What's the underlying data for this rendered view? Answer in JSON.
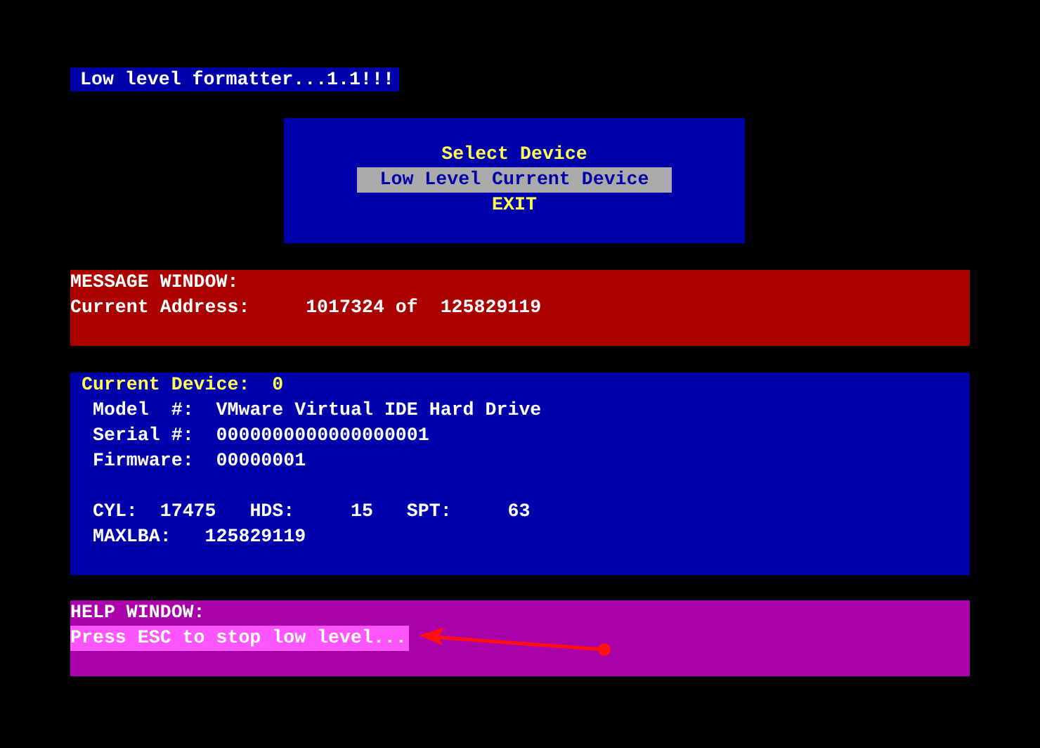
{
  "title": "Low level formatter...1.1!!!",
  "menu": {
    "items": [
      {
        "label": "Select Device",
        "selected": false
      },
      {
        "label": "Low Level Current Device",
        "selected": true
      },
      {
        "label": "EXIT",
        "selected": false
      }
    ]
  },
  "message_window": {
    "heading": "MESSAGE WINDOW:",
    "lines": [
      "Current Address:     1017324 of  125829119"
    ]
  },
  "device_window": {
    "heading": "Current Device:  0",
    "lines": [
      " Model  #:  VMware Virtual IDE Hard Drive",
      " Serial #:  0000000000000000001",
      " Firmware:  00000001"
    ],
    "geometry_lines": [
      " CYL:  17475   HDS:     15   SPT:     63",
      " MAXLBA:   125829119"
    ]
  },
  "help_window": {
    "heading": "HELP WINDOW:",
    "lines": [
      {
        "text": "Press ESC to stop low level...",
        "highlighted": true
      }
    ]
  }
}
